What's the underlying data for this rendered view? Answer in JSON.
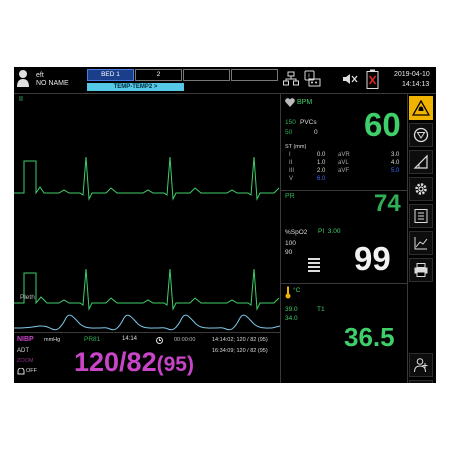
{
  "header": {
    "patient_bed": "eft",
    "patient_name": "NO NAME",
    "bed_tabs": [
      "BED 1",
      "2",
      "",
      ""
    ],
    "temp_tab": "TEMP-TEMP2 >",
    "date": "2019-04-10",
    "time": "14:14:13"
  },
  "waveforms": {
    "ecg1_label": "II",
    "pleth_label": "Pleth"
  },
  "hr": {
    "label": "BPM",
    "value": "60",
    "pvcs_limit_hi": "150",
    "pvcs_label": "PVCs",
    "pvcs_limit_lo": "50",
    "pvcs_value": "0",
    "st_label": "ST (mm)",
    "st_rows": [
      {
        "l1": "I",
        "v1": "0.0",
        "l2": "aVR",
        "v2": "3.0"
      },
      {
        "l1": "II",
        "v1": "1.0",
        "l2": "aVL",
        "v2": "4.0"
      },
      {
        "l1": "III",
        "v1": "2.0",
        "l2": "aVF",
        "v2": "5.0"
      },
      {
        "l1": "V",
        "v1": "6.0",
        "l2": "",
        "v2": ""
      }
    ]
  },
  "pr": {
    "label": "PR",
    "value": "74"
  },
  "spo2": {
    "label": "%SpO2",
    "pi_label": "PI",
    "pi_value": "3.00",
    "limit_hi": "100",
    "limit_lo": "90",
    "value": "99"
  },
  "temp": {
    "unit": "°C",
    "limit_hi": "39.0",
    "limit_lo": "34.0",
    "channel": "T1",
    "value": "36.5"
  },
  "nibp": {
    "label": "NIBP",
    "unit": "mmHg",
    "pr_label": "PR",
    "pr_value": "81",
    "time": "14:14",
    "timer": "00:00:00",
    "mode": "ADT",
    "cuff_label": "ZOOM",
    "alarm_off": "OFF",
    "value": "120/82",
    "mean": "(95)",
    "history": [
      "14:14:02; 120 / 82 (95)",
      "16:34:09; 120 / 82 (95)"
    ]
  },
  "colors": {
    "ecg": "#3fcf6a",
    "pleth": "#7fc8e8",
    "nibp": "#c845c8",
    "spo2": "#f2f2f2"
  }
}
